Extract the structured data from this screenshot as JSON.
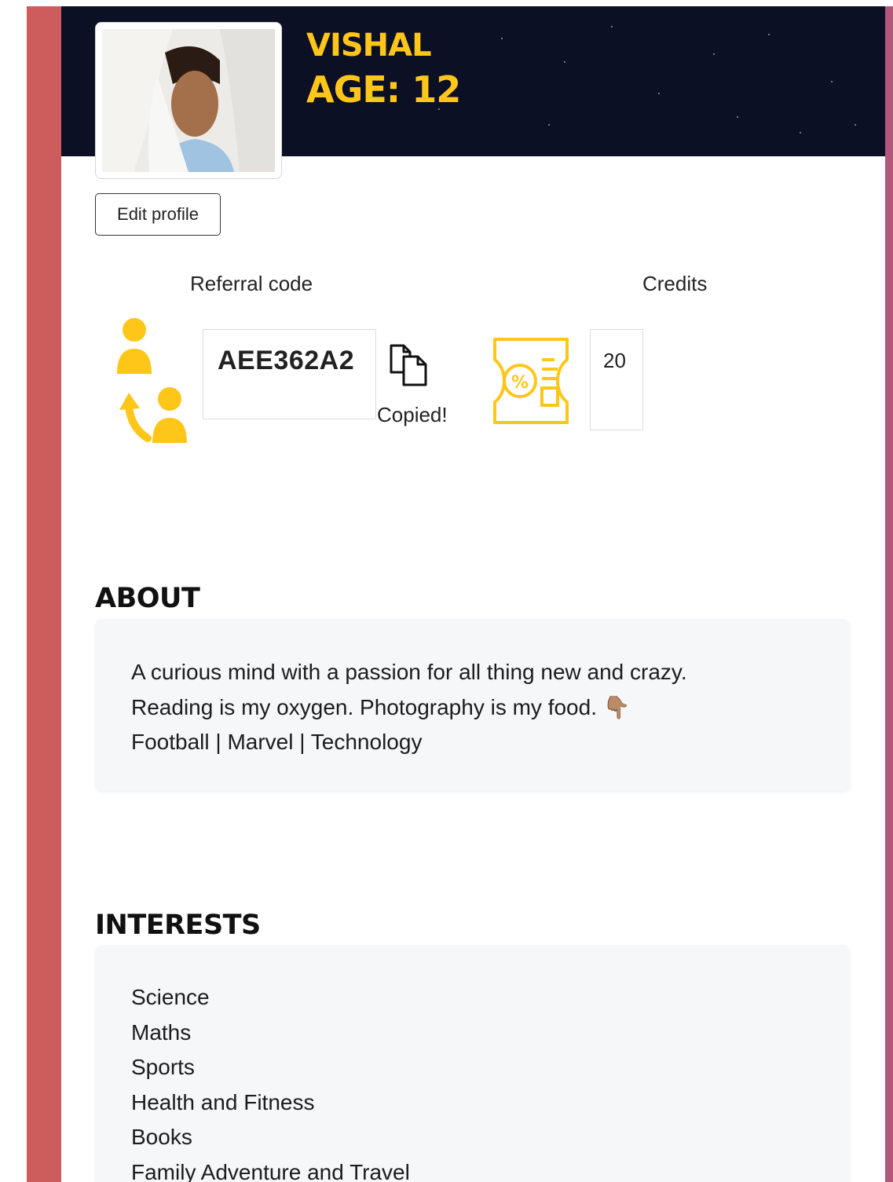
{
  "profile": {
    "name": "VISHAL",
    "age_label": "AGE: 12",
    "edit_button": "Edit profile"
  },
  "referral": {
    "label": "Referral code",
    "code": "AEE362A2",
    "copy_status": "Copied!"
  },
  "credits": {
    "label": "Credits",
    "value": "20"
  },
  "about": {
    "title": "ABOUT",
    "lines": [
      "A curious mind with a passion for all thing new and crazy.",
      "Reading is my oxygen. Photography is my food. 👇🏽",
      "Football | Marvel | Technology"
    ]
  },
  "interests": {
    "title": "INTERESTS",
    "items": [
      "Science",
      "Maths",
      "Sports",
      "Health and Fitness",
      "Books",
      "Family Adventure and Travel"
    ]
  },
  "icons": {
    "referral": "referral-users-icon",
    "copy": "copy-icon",
    "credits": "coupon-icon"
  },
  "colors": {
    "accent": "#ffc61a",
    "banner": "#0b1024",
    "frame_left": "#cd5c5d",
    "frame_right": "#b1577a",
    "card": "#f6f7f9"
  }
}
